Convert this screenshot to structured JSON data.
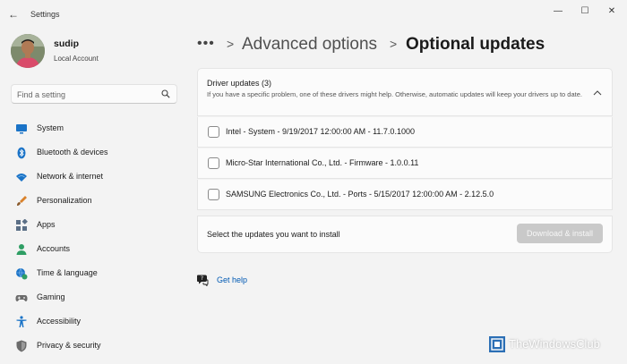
{
  "window": {
    "title": "Settings",
    "controls": {
      "minimize": "—",
      "maximize": "☐",
      "close": "✕"
    }
  },
  "user": {
    "name": "sudip",
    "account_type": "Local Account"
  },
  "search": {
    "placeholder": "Find a setting"
  },
  "sidebar": {
    "items": [
      {
        "label": "System",
        "icon": "monitor-icon",
        "color": "#1a73c7"
      },
      {
        "label": "Bluetooth & devices",
        "icon": "bluetooth-icon",
        "color": "#1a73c7"
      },
      {
        "label": "Network & internet",
        "icon": "wifi-icon",
        "color": "#1a73c7"
      },
      {
        "label": "Personalization",
        "icon": "brush-icon",
        "color": "#d9822b"
      },
      {
        "label": "Apps",
        "icon": "apps-icon",
        "color": "#5b6f86"
      },
      {
        "label": "Accounts",
        "icon": "person-icon",
        "color": "#2f9e64"
      },
      {
        "label": "Time & language",
        "icon": "globe-clock-icon",
        "color": "#1a73c7"
      },
      {
        "label": "Gaming",
        "icon": "gamepad-icon",
        "color": "#6b6b6b"
      },
      {
        "label": "Accessibility",
        "icon": "accessibility-icon",
        "color": "#1a73c7"
      },
      {
        "label": "Privacy & security",
        "icon": "shield-icon",
        "color": "#6b6b6b"
      }
    ]
  },
  "breadcrumb": {
    "more": "•••",
    "separator": ">",
    "parent": "Advanced options",
    "current": "Optional updates"
  },
  "driver_updates": {
    "title": "Driver updates (3)",
    "description": "If you have a specific problem, one of these drivers might help. Otherwise, automatic updates will keep your drivers up to date.",
    "items": [
      {
        "label": "Intel - System - 9/19/2017 12:00:00 AM - 11.7.0.1000",
        "checked": false
      },
      {
        "label": "Micro-Star International Co., Ltd. - Firmware - 1.0.0.11",
        "checked": false
      },
      {
        "label": "SAMSUNG Electronics Co., Ltd.  - Ports - 5/15/2017 12:00:00 AM - 2.12.5.0",
        "checked": false
      }
    ]
  },
  "install": {
    "prompt": "Select the updates you want to install",
    "button_label": "Download & install",
    "enabled": false
  },
  "help": {
    "label": "Get help"
  },
  "watermark": {
    "text": "TheWindowsClub"
  }
}
